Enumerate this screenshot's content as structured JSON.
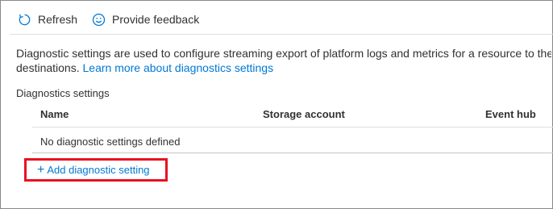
{
  "toolbar": {
    "refresh_label": "Refresh",
    "feedback_label": "Provide feedback"
  },
  "description": {
    "line1": "Diagnostic settings are used to configure streaming export of platform logs and metrics for a resource to the destina",
    "line2_prefix": "destinations. ",
    "learn_more_link": "Learn more about diagnostics settings"
  },
  "section_title": "Diagnostics settings",
  "table": {
    "columns": [
      "Name",
      "Storage account",
      "Event hub"
    ],
    "empty_message": "No diagnostic settings defined"
  },
  "add_setting_label": "Add diagnostic setting",
  "colors": {
    "accent": "#0078d4",
    "highlight_border": "#e81123"
  },
  "icons": {
    "refresh": "refresh-icon",
    "feedback": "smiley-icon",
    "add": "plus-icon"
  }
}
